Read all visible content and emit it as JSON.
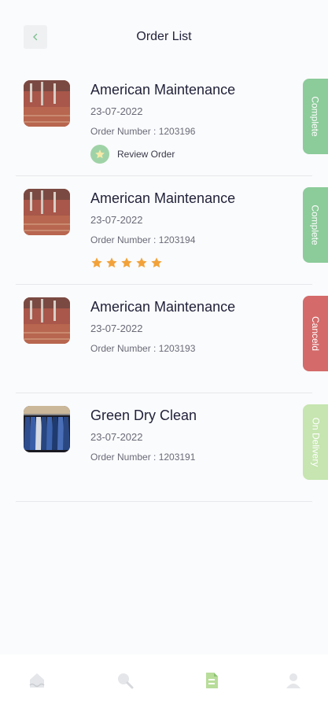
{
  "header": {
    "title": "Order List",
    "back_icon": "chevron-left-icon"
  },
  "colors": {
    "complete": "#8ccb9a",
    "canceled": "#d46a6a",
    "on_delivery": "#c6e5b0",
    "star": "#f2a23a",
    "accent": "#9fd3a7"
  },
  "orders": [
    {
      "name": "American Maintenance",
      "date": "23-07-2022",
      "order_number": "Order Number : 1203196",
      "status": "Complete",
      "action": "Review Order",
      "image": "laundry-shop-thumbnail"
    },
    {
      "name": "American Maintenance",
      "date": "23-07-2022",
      "order_number": "Order Number : 1203194",
      "status": "Complete",
      "rating": 5,
      "image": "laundry-shop-thumbnail"
    },
    {
      "name": "American Maintenance",
      "date": "23-07-2022",
      "order_number": "Order Number : 1203193",
      "status": "Canceld",
      "image": "laundry-shop-thumbnail"
    },
    {
      "name": "Green Dry Clean",
      "date": "23-07-2022",
      "order_number": "Order Number : 1203191",
      "status": "On Delivery",
      "image": "clothes-rack-thumbnail"
    }
  ],
  "navbar": {
    "items": [
      "home-icon",
      "search-icon",
      "orders-icon",
      "profile-icon"
    ],
    "active": "orders-icon"
  }
}
